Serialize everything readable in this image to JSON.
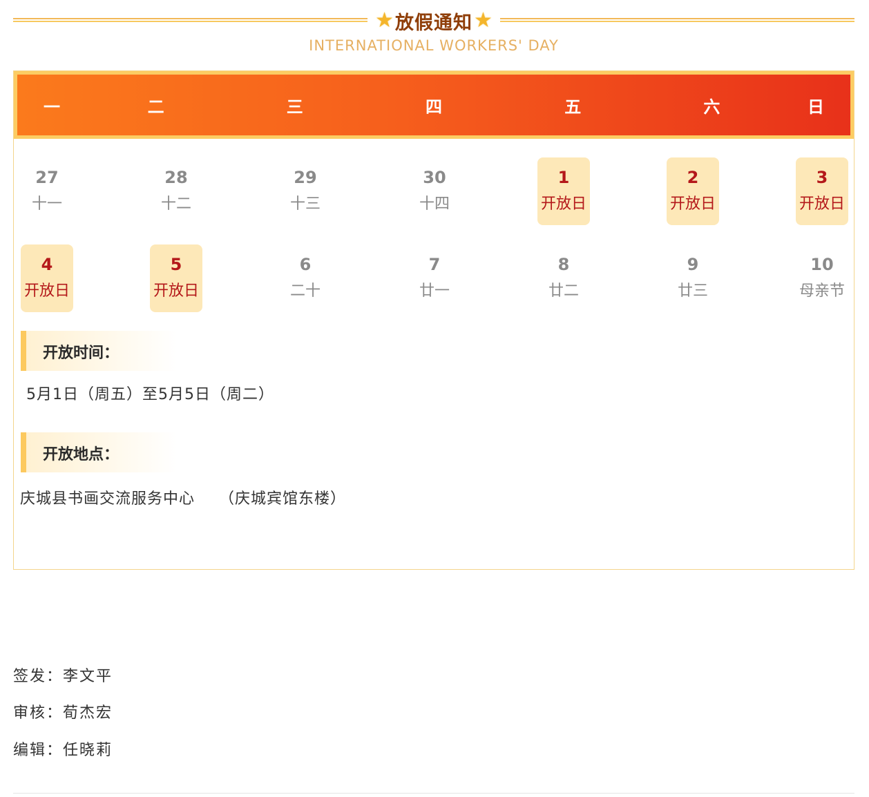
{
  "header": {
    "title": "放假通知",
    "subtitle": "INTERNATIONAL WORKERS' DAY",
    "star_icon": "star-icon",
    "colors": {
      "title": "#8f3e08",
      "subtitle": "#e6b062",
      "line": "#f2b856",
      "star": "#f4b52c"
    }
  },
  "calendar": {
    "weekdays": [
      "一",
      "二",
      "三",
      "四",
      "五",
      "六",
      "日"
    ],
    "rows": [
      [
        {
          "num": "27",
          "lunar": "十一",
          "holiday": false
        },
        {
          "num": "28",
          "lunar": "十二",
          "holiday": false
        },
        {
          "num": "29",
          "lunar": "十三",
          "holiday": false
        },
        {
          "num": "30",
          "lunar": "十四",
          "holiday": false
        },
        {
          "num": "1",
          "lunar": "开放日",
          "holiday": true
        },
        {
          "num": "2",
          "lunar": "开放日",
          "holiday": true
        },
        {
          "num": "3",
          "lunar": "开放日",
          "holiday": true
        }
      ],
      [
        {
          "num": "4",
          "lunar": "开放日",
          "holiday": true
        },
        {
          "num": "5",
          "lunar": "开放日",
          "holiday": true
        },
        {
          "num": "6",
          "lunar": "二十",
          "holiday": false
        },
        {
          "num": "7",
          "lunar": "廿一",
          "holiday": false
        },
        {
          "num": "8",
          "lunar": "廿二",
          "holiday": false
        },
        {
          "num": "9",
          "lunar": "廿三",
          "holiday": false
        },
        {
          "num": "10",
          "lunar": "母亲节",
          "holiday": false
        }
      ]
    ],
    "colors": {
      "bar_start": "#fb7a1c",
      "bar_end": "#e8311a",
      "bar_border": "#fccc63",
      "holiday_bg": "#fde8b8",
      "holiday_text": "#b4181a",
      "normal_text": "#8a8a8a"
    }
  },
  "sections": {
    "time": {
      "label": "开放时间：",
      "text": "5月1日（周五）至5月5日（周二）"
    },
    "place": {
      "label": "开放地点：",
      "text": "庆城县书画交流服务中心　　（庆城宾馆东楼）"
    }
  },
  "credits": [
    {
      "text": "签发：李文平"
    },
    {
      "text": "审核：荀杰宏"
    },
    {
      "text": "编辑：任晓莉"
    }
  ]
}
